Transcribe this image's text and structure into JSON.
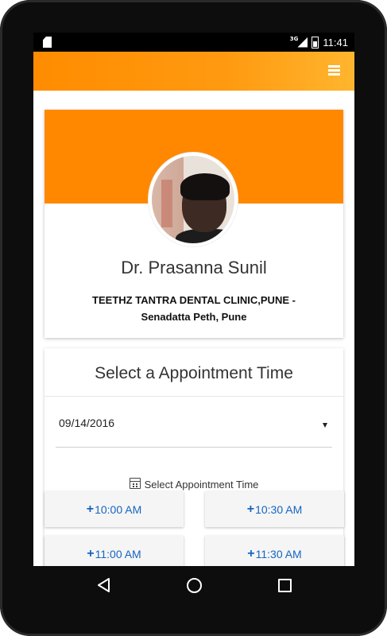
{
  "status_bar": {
    "network": "3G",
    "time": "11:41",
    "icons": [
      "sd-card-icon",
      "signal-icon",
      "battery-icon"
    ]
  },
  "app_bar": {
    "menu_icon": "hamburger-menu-icon",
    "color_start": "#ff8c00",
    "color_end": "#ffb52e"
  },
  "profile": {
    "doctor_name": "Dr. Prasanna Sunil",
    "clinic_line1": "TEETHZ TANTRA DENTAL CLINIC,PUNE -",
    "clinic_line2": "Senadatta Peth, Pune",
    "banner_color": "#ff8800"
  },
  "appointment": {
    "title": "Select a Appointment Time",
    "date_value": "09/14/2016",
    "time_label": "Select Appointment Time",
    "time_icon": "calendar-icon",
    "slot_prefix": "+",
    "slots": [
      "10:00 AM",
      "10:30 AM",
      "11:00 AM",
      "11:30 AM"
    ],
    "slot_text_color": "#1565c0"
  },
  "nav_bar": {
    "icons": [
      "back-icon",
      "home-icon",
      "recent-apps-icon"
    ]
  }
}
